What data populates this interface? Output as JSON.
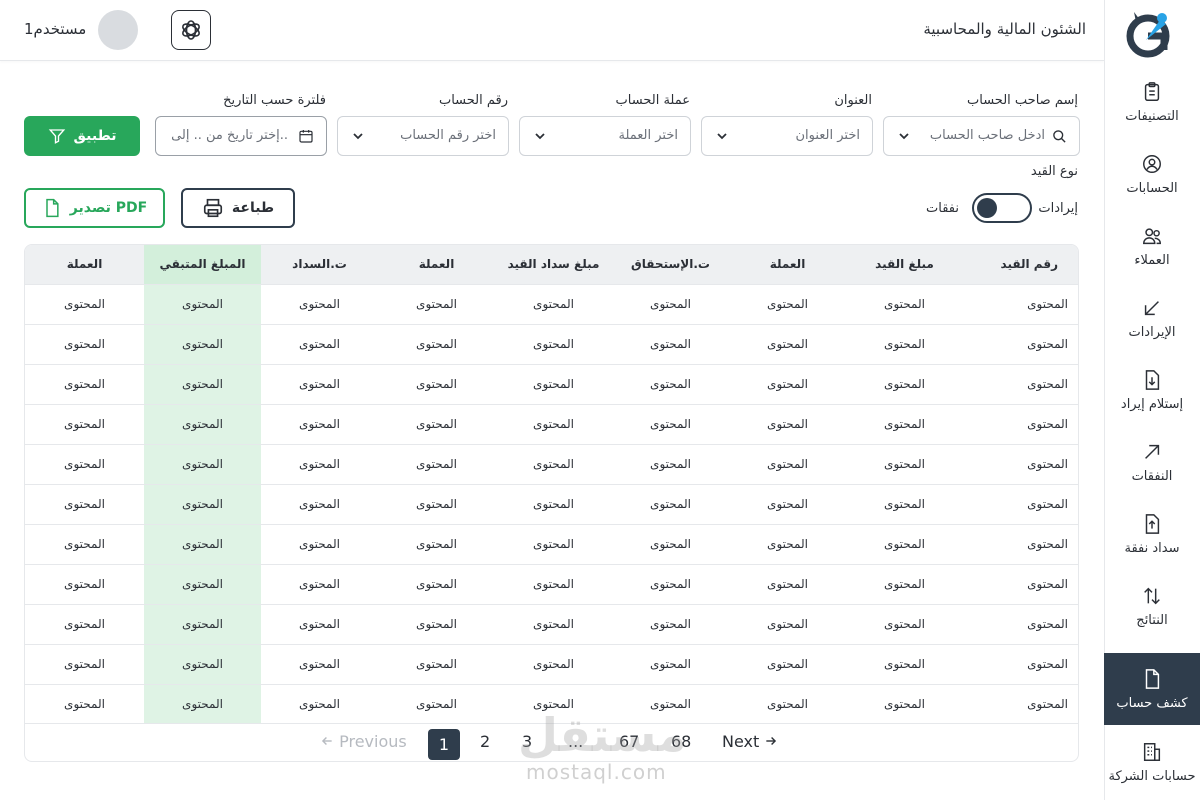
{
  "app": {
    "title": "الشئون المالية والمحاسبية",
    "user_name": "مستخدم1"
  },
  "sidebar": {
    "items": [
      {
        "label": "التصنيفات",
        "icon": "clipboard-icon"
      },
      {
        "label": "الحسابات",
        "icon": "user-circle-icon"
      },
      {
        "label": "العملاء",
        "icon": "users-icon"
      },
      {
        "label": "الإيرادات",
        "icon": "arrow-down-left-icon"
      },
      {
        "label": "إستلام إيراد",
        "icon": "file-download-icon"
      },
      {
        "label": "النفقات",
        "icon": "arrow-up-right-icon"
      },
      {
        "label": "سداد نفقة",
        "icon": "file-upload-icon"
      },
      {
        "label": "النتائج",
        "icon": "arrows-up-down-icon"
      },
      {
        "label": "كشف حساب",
        "icon": "file-icon",
        "active": true
      },
      {
        "label": "حسابات الشركة",
        "icon": "building-icon"
      }
    ]
  },
  "filters": {
    "account_holder": {
      "label": "إسم صاحب الحساب",
      "placeholder": "ادخل صاحب الحساب"
    },
    "address": {
      "label": "العنوان",
      "placeholder": "اختر العنوان"
    },
    "currency": {
      "label": "عملة الحساب",
      "placeholder": "اختر العملة"
    },
    "account_number": {
      "label": "رقم الحساب",
      "placeholder": "اختر رقم الحساب"
    },
    "date_range": {
      "label": "فلترة حسب التاريخ",
      "placeholder": "إختر تاريخ من .. إلى.."
    },
    "apply_label": "تطبيق"
  },
  "entry_type": {
    "label": "نوع القيد",
    "revenue_label": "إيرادات",
    "expense_label": "نفقات"
  },
  "actions": {
    "print_label": "طباعة",
    "export_label": "تصدير PDF"
  },
  "table": {
    "headers": [
      "رقم القيد",
      "مبلغ القيد",
      "العملة",
      "ت.الإستحقاق",
      "مبلغ سداد القيد",
      "العملة",
      "ت.السداد",
      "المبلغ المتبقي",
      "العملة"
    ],
    "cell_value": "المحتوى",
    "row_count": 11
  },
  "pagination": {
    "previous": "Previous",
    "next": "Next",
    "pages": [
      "1",
      "2",
      "3",
      "...",
      "67",
      "68"
    ],
    "current": "1"
  },
  "watermark": {
    "brand": "مستقل",
    "domain": "mostaql.com"
  },
  "colors": {
    "primary_dark": "#2f3d4c",
    "accent_green": "#28a75b",
    "highlight_green": "#dff3e5"
  }
}
